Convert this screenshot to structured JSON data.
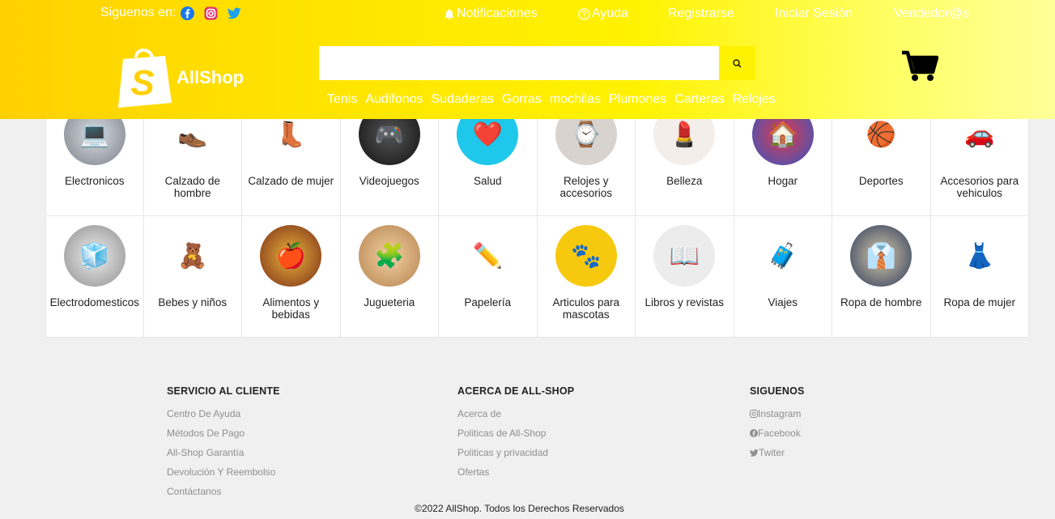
{
  "header": {
    "follow_label": "Siguenos en:",
    "social_icons": [
      "facebook-icon",
      "instagram-icon",
      "twitter-icon"
    ],
    "nav": {
      "notifications": "Notificaciones",
      "help": "Ayuda",
      "register": "Registrarse",
      "login": "Iniciar Sesión",
      "sellers": "Vendedor@s"
    },
    "logo_text": "AllShop",
    "search": {
      "value": "",
      "placeholder": ""
    },
    "categories": [
      "Tenis",
      "Audifonos",
      "Sudaderas",
      "Gorras",
      "mochilas",
      "Plumones",
      "Carteras",
      "Relojes"
    ],
    "brand_color": "#ffe400"
  },
  "grid": {
    "row1": [
      "Electronicos",
      "Calzado de hombre",
      "Calzado de mujer",
      "Videojuegos",
      "Salud",
      "Relojes y accesorios",
      "Belleza",
      "Hogar",
      "Deportes",
      "Accesorios para vehiculos"
    ],
    "row2": [
      "Electrodomesticos",
      "Bebes y niños",
      "Alimentos y bebidas",
      "Jugueteria",
      "Papelería",
      "Articulos para mascotas",
      "Libros y revistas",
      "Viajes",
      "Ropa de hombre",
      "Ropa de mujer"
    ]
  },
  "footer": {
    "customer_service": {
      "title": "SERVICIO AL CLIENTE",
      "links": [
        "Centro De Ayuda",
        "Métodos De Pago",
        "All-Shop Garantía",
        "Devolución Y Reembolso",
        "Contáctanos"
      ]
    },
    "about": {
      "title": "ACERCA DE ALL-SHOP",
      "links": [
        "Acerca de",
        "Politicas de All-Shop",
        "Politicas y privacidad",
        "Ofertas"
      ]
    },
    "follow": {
      "title": "SIGUENOS",
      "links": [
        "Instagram",
        "Facebook",
        "Twiter"
      ]
    },
    "copyright": "©2022 AllShop. Todos los Derechos Reservados"
  }
}
